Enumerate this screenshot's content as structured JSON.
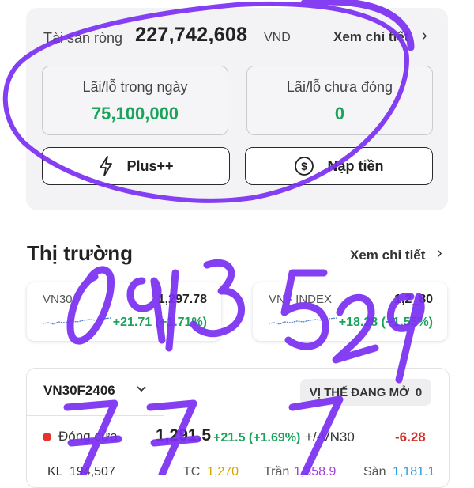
{
  "account": {
    "net_asset_label": "Tài sản ròng",
    "net_asset_value": "227,742,608",
    "currency": "VND",
    "detail_link": "Xem chi tiết",
    "day_pl_label": "Lãi/lỗ trong ngày",
    "day_pl_value": "75,100,000",
    "unrealized_pl_label": "Lãi/lỗ chưa đóng",
    "unrealized_pl_value": "0",
    "plus_button": "Plus++",
    "deposit_button": "Nạp tiền"
  },
  "market": {
    "title": "Thị trường",
    "detail_link": "Xem chi tiết",
    "indices": [
      {
        "name": "VN30",
        "value": "1,297.78",
        "change": "+21.71 (+1.71%)"
      },
      {
        "name": "VN - INDEX",
        "value": "1,2_80",
        "change": "+18.28 (+1.55%)"
      }
    ]
  },
  "futures": {
    "symbol": "VN30F2406",
    "position_label": "VỊ THẾ ĐANG MỞ",
    "position_count": "0",
    "close_label": "Đóng cửa",
    "close_value": "1,291.5",
    "close_change": "+21.5 (+1.69%)",
    "basis_label": "+/-VN30",
    "basis_value": "-6.28",
    "row3": {
      "vol_label": "KL",
      "vol_value": "194,507",
      "tc_label": "TC",
      "tc_value": "1,270",
      "tran_label": "Trần",
      "tran_value": "1,358.9",
      "san_label": "Sàn",
      "san_value": "1,181.1"
    }
  },
  "overlay": {
    "handwriting": "0913 529 777",
    "ink_color": "#7b2ff2"
  }
}
